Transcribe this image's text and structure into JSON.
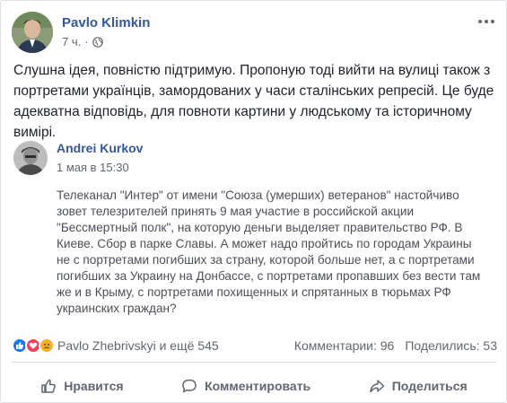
{
  "post": {
    "author": "Pavlo Klimkin",
    "time": "7 ч.",
    "dot": "·",
    "text": "Слушна ідея, повністю підтримую. Пропоную тоді вийти на вулиці також з портретами українців, замордованих у часи сталінських репресій. Це буде адекватна відповідь, для повноти картини у людському та історичному вимірі."
  },
  "shared": {
    "author": "Andrei Kurkov",
    "date": "1 мая в 15:30",
    "text": "Телеканал \"Интер\" от имени \"Союза (умерших) ветеранов\" настойчиво зовет телезрителей принять 9 мая участие в российской акции \"Бессмертный полк\", на которую деньги выделяет правительство РФ. В Киеве. Сбор в парке Славы. А может надо пройтись по городам Украины не с портретами погибших за страну, которой больше нет, а с портретами погибших за Украину на Донбассе, с портретами пропавших без вести там же и в Крыму, с портретами похищенных и спрятанных в тюрьмах РФ украинских граждан?"
  },
  "reactions": {
    "names": "Pavlo Zhebrivskyi и ещё 545",
    "comments": "Комментарии: 96",
    "shares": "Поделились: 53"
  },
  "actions": {
    "like": "Нравится",
    "comment": "Комментировать",
    "share": "Поделиться"
  },
  "colors": {
    "link": "#365899",
    "like": "#1877f2",
    "love": "#f33e58",
    "sad": "#f7b125"
  }
}
